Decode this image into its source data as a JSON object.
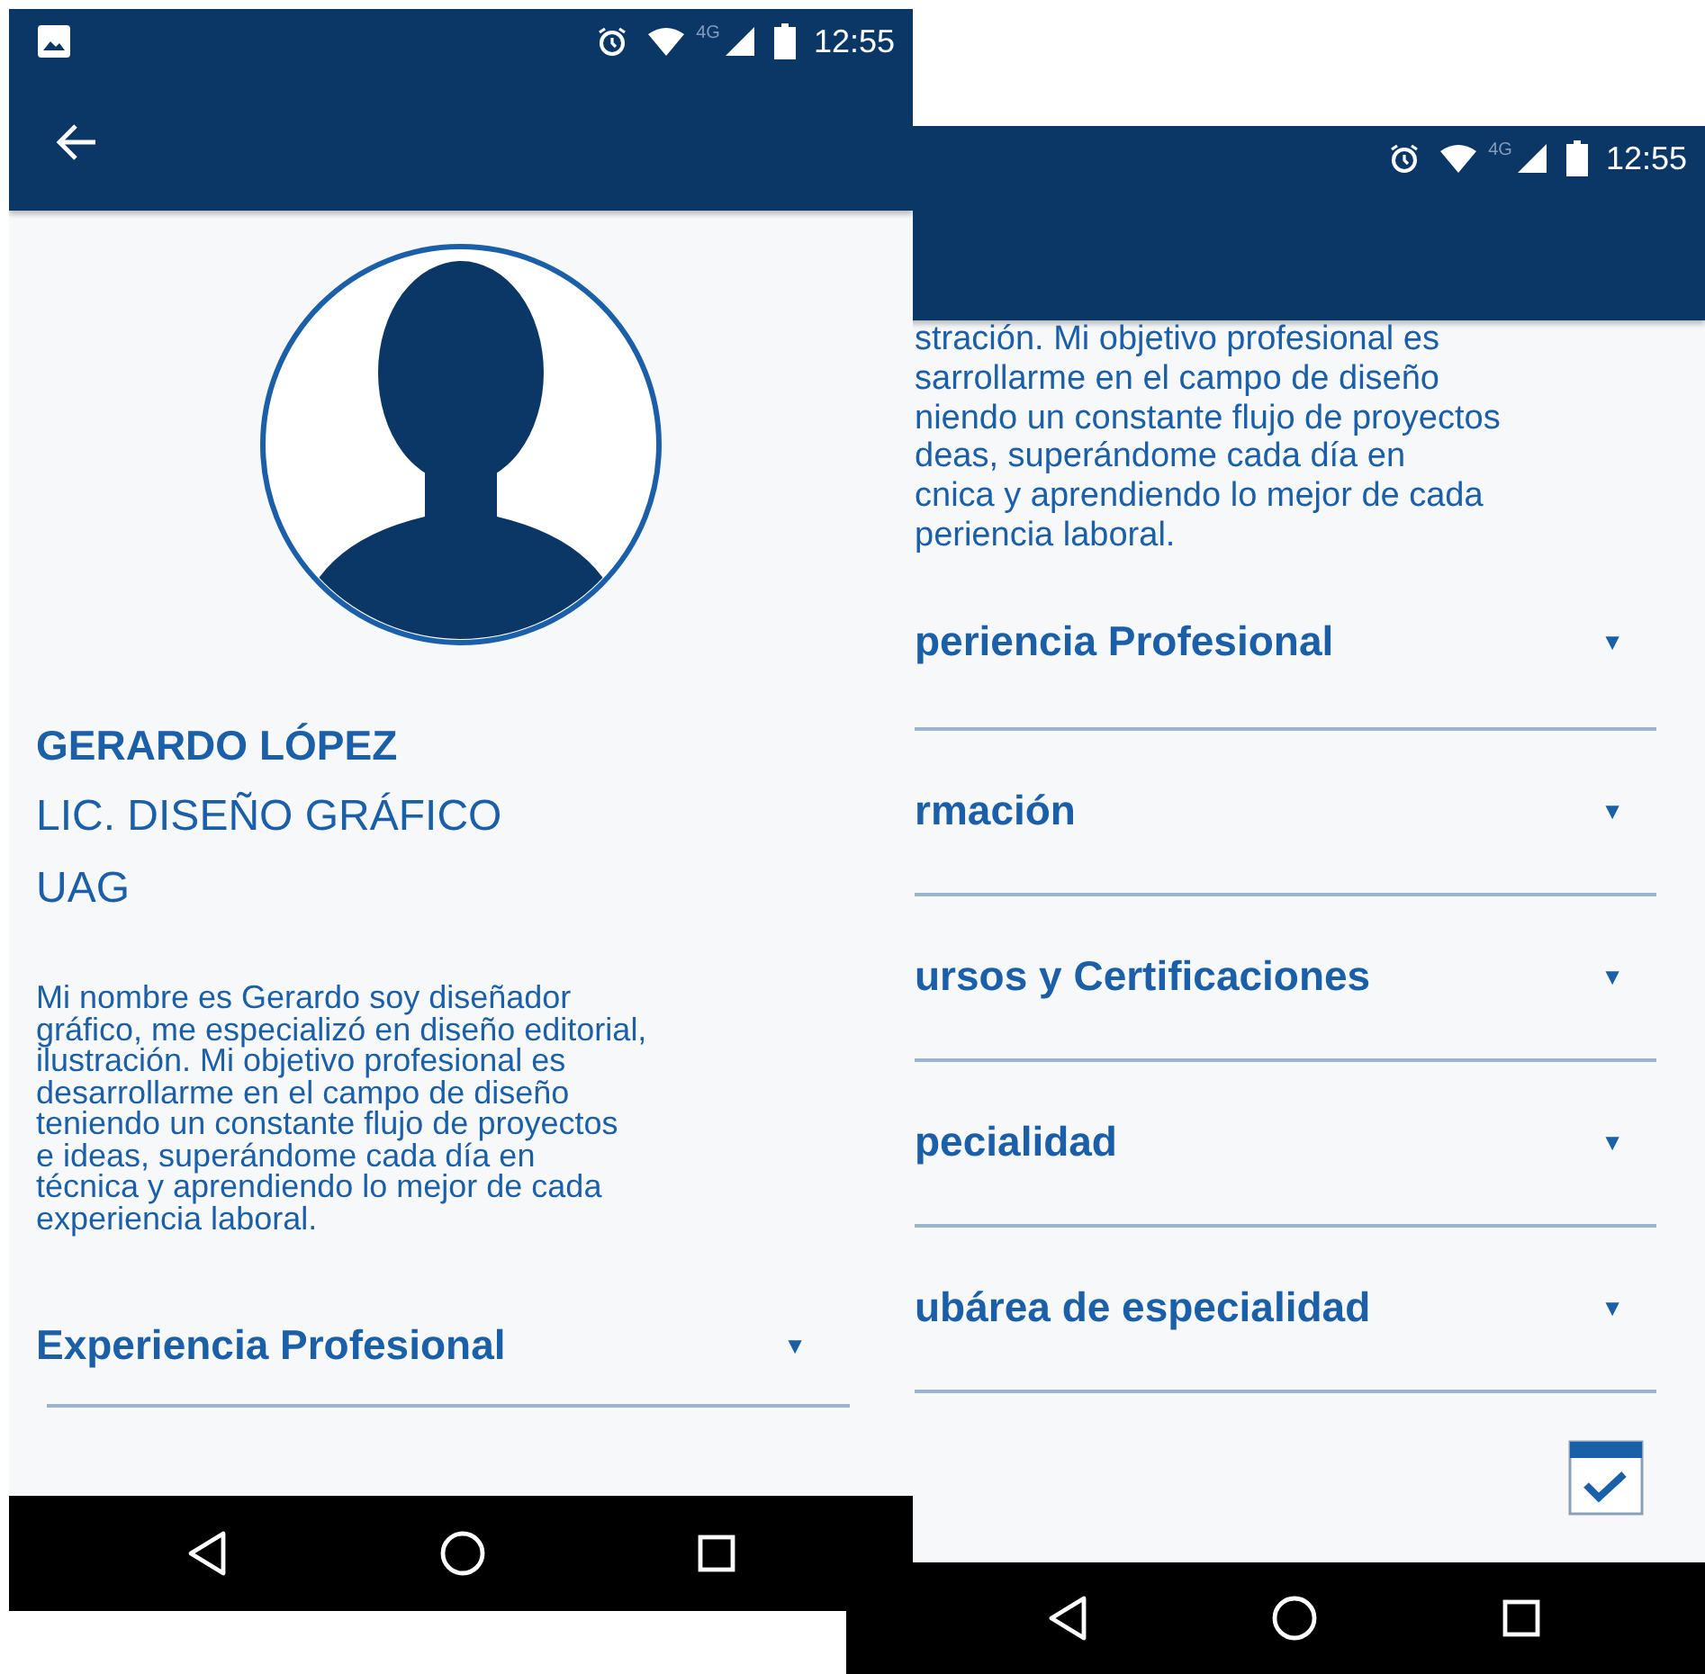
{
  "left_screen": {
    "status_bar": {
      "network": "4G",
      "time": "12:55"
    },
    "profile": {
      "name": "GERARDO LÓPEZ",
      "degree": "LIC. DISEÑO GRÁFICO",
      "school": "UAG",
      "bio_lines": [
        "Mi nombre es Gerardo soy diseñador",
        "gráfico, me especializó en diseño editorial,",
        "ilustración. Mi objetivo profesional es",
        "desarrollarme en el campo de diseño",
        "teniendo un constante flujo de proyectos",
        "e ideas, superándome cada día en",
        "técnica y aprendiendo lo mejor de cada",
        "experiencia laboral."
      ]
    },
    "sections": [
      {
        "label": "Experiencia Profesional",
        "caret": "▼"
      }
    ]
  },
  "right_screen": {
    "status_bar": {
      "network": "4G",
      "time": "12:55"
    },
    "bio_lines": [
      "stración. Mi objetivo profesional es",
      "sarrollarme en el campo de diseño",
      "niendo un constante flujo de proyectos",
      "deas, superándome cada día en",
      "cnica y aprendiendo lo mejor de cada",
      "periencia laboral."
    ],
    "sections": [
      {
        "label": "periencia Profesional",
        "caret": "▼"
      },
      {
        "label": "rmación",
        "caret": "▼"
      },
      {
        "label": "ursos y Certificaciones",
        "caret": "▼"
      },
      {
        "label": "pecialidad",
        "caret": "▼"
      },
      {
        "label": "ubárea de especialidad",
        "caret": "▼"
      }
    ]
  }
}
